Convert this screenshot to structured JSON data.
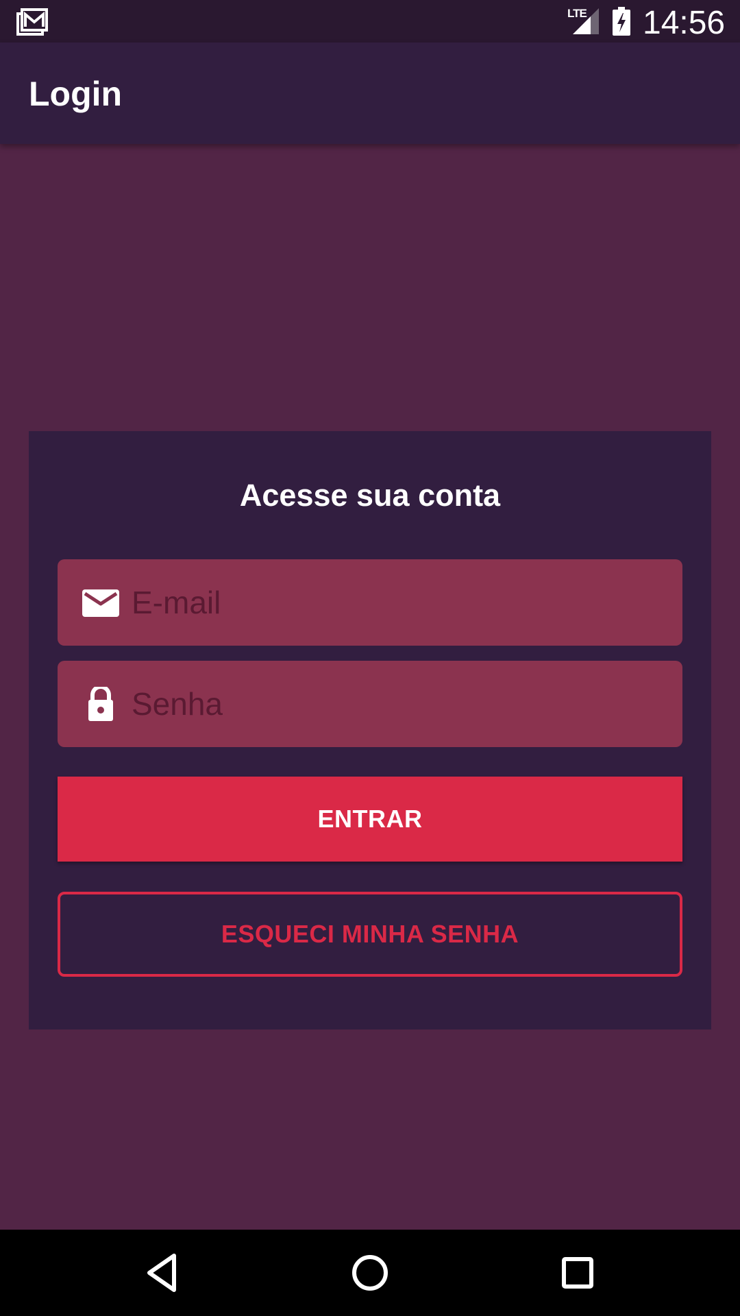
{
  "status_bar": {
    "time": "14:56",
    "network": "LTE",
    "icons": [
      "notification-gallery-icon",
      "signal-icon",
      "battery-charging-icon"
    ]
  },
  "app_bar": {
    "title": "Login"
  },
  "login_card": {
    "title": "Acesse sua conta",
    "email": {
      "placeholder": "E-mail",
      "value": "",
      "icon": "mail-icon"
    },
    "password": {
      "placeholder": "Senha",
      "value": "",
      "icon": "lock-icon"
    },
    "submit_label": "ENTRAR",
    "forgot_label": "ESQUECI MINHA SENHA"
  },
  "nav_bar": {
    "icons": [
      "back-icon",
      "home-icon",
      "recents-icon"
    ]
  },
  "colors": {
    "background": "#522546",
    "app_bar": "#321e40",
    "card": "#321e40",
    "field": "#8b334f",
    "accent": "#da2947",
    "status_bar": "#2a1830"
  }
}
